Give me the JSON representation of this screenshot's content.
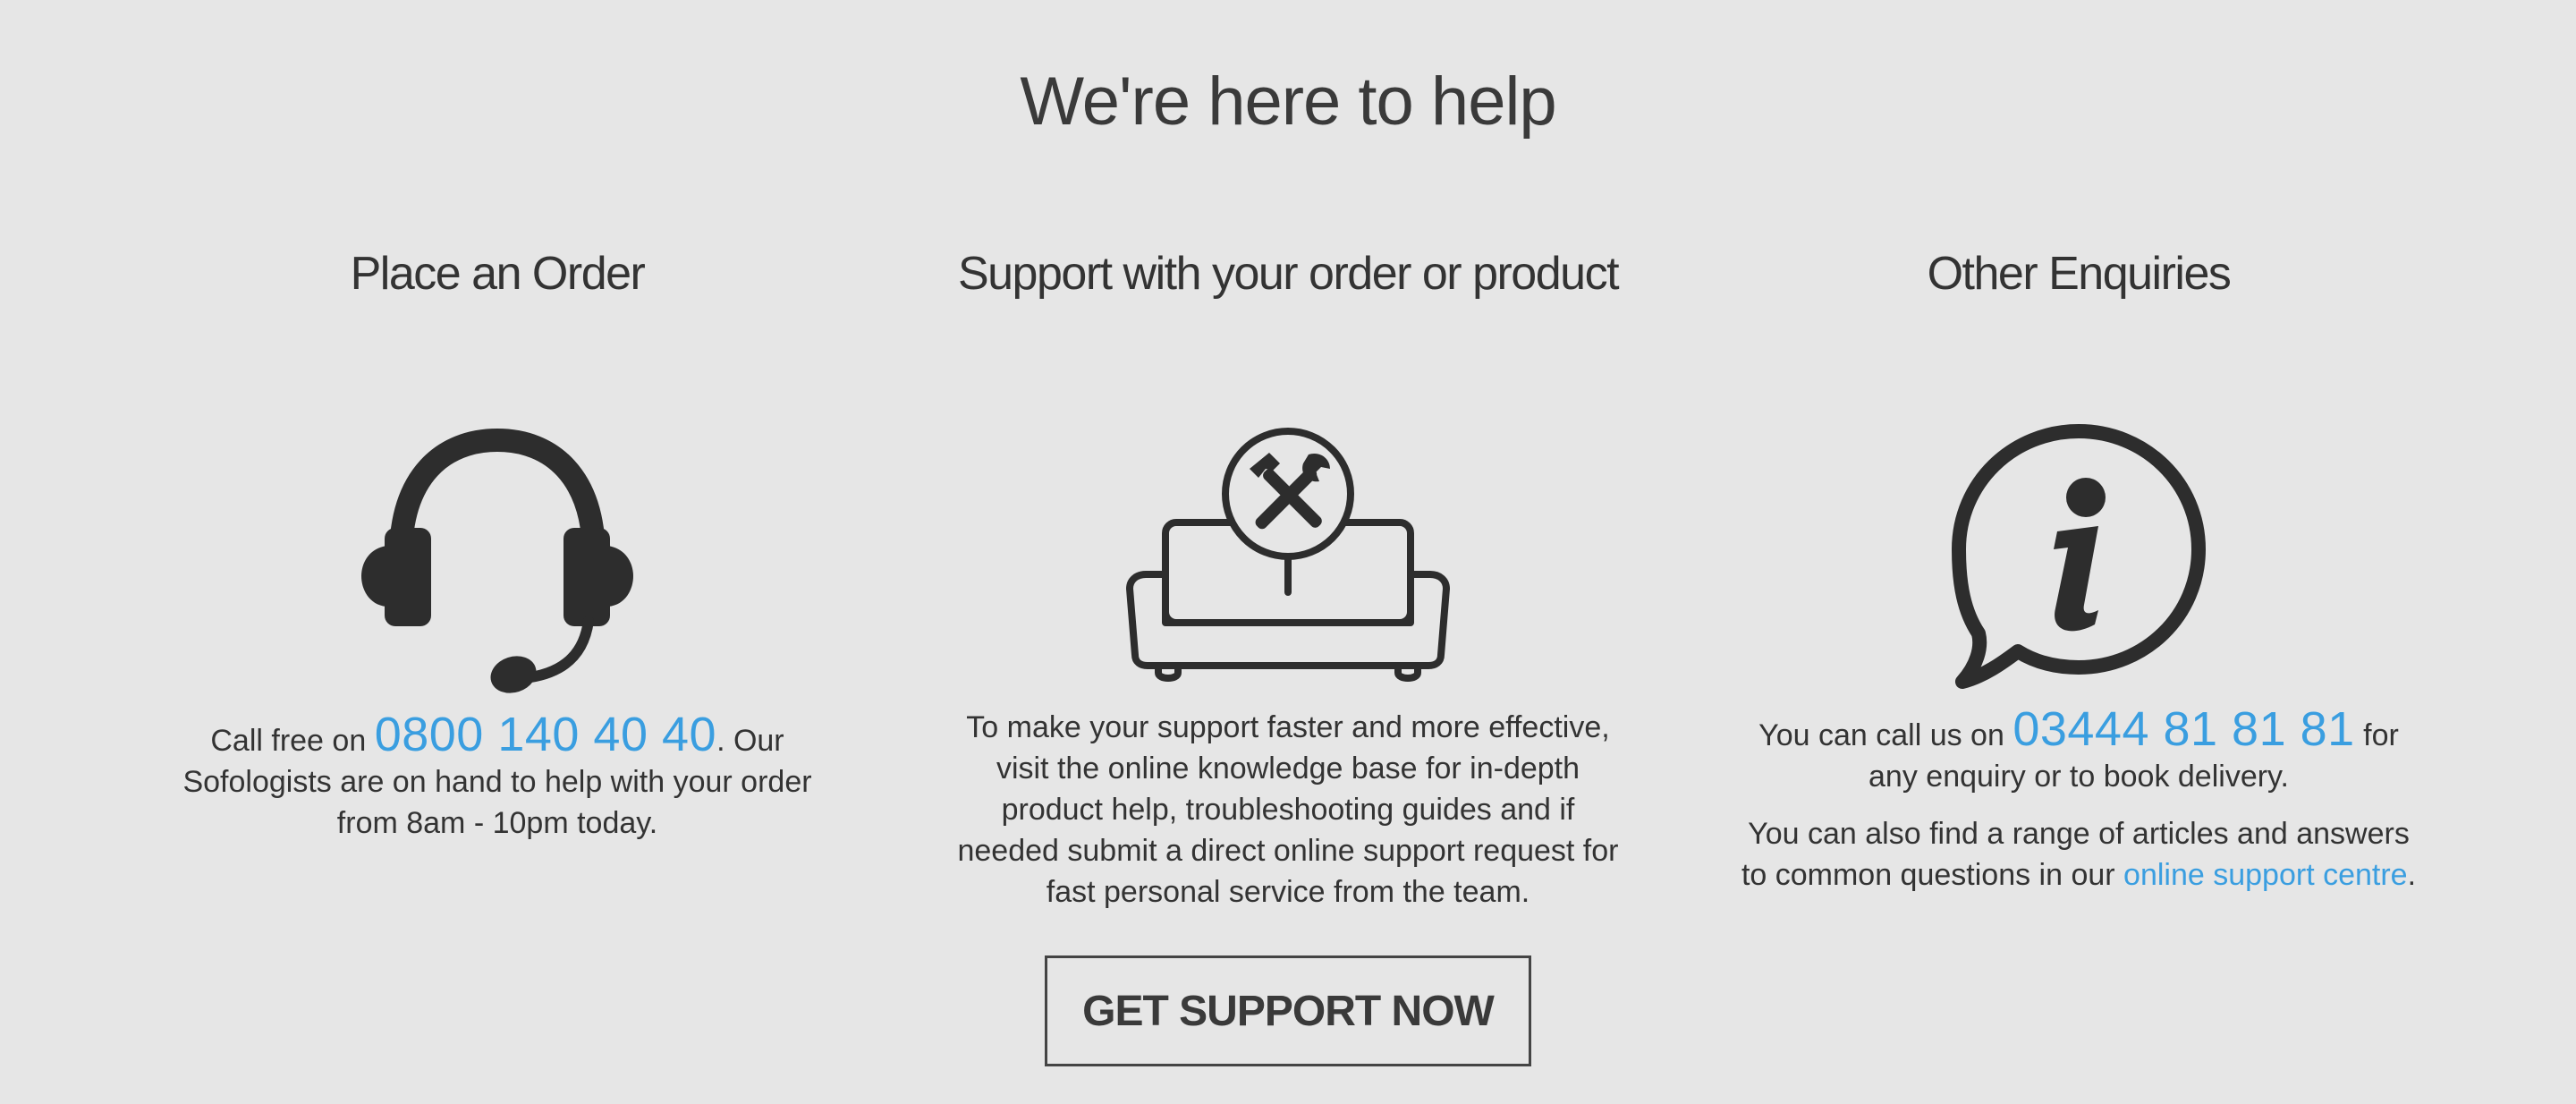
{
  "page": {
    "title": "We're here to help"
  },
  "colors": {
    "background": "#e6e6e6",
    "text": "#333333",
    "accent_link": "#3a9ee0",
    "icon": "#2d2d2d"
  },
  "columns": {
    "order": {
      "heading": "Place an Order",
      "icon": "headset-icon",
      "text_before": "Call free on ",
      "phone": "0800 140 40 40",
      "text_after": ". Our Sofologists are on hand to help with your order from 8am - 10pm today."
    },
    "support": {
      "heading": "Support with your order or product",
      "icon": "sofa-tools-icon",
      "text": "To make your support faster and more effective, visit the online knowledge base for in-depth product help, troubleshooting guides and if needed submit a direct online support request for fast personal service from the team.",
      "button_label": "GET SUPPORT NOW"
    },
    "other": {
      "heading": "Other Enquiries",
      "icon": "info-speech-bubble-icon",
      "text_before": "You can call us on ",
      "phone": "03444 81 81 81",
      "text_after": " for any enquiry or to book delivery.",
      "second_before": "You can also find a range of articles and answers to common questions in our ",
      "second_link": "online support centre",
      "second_after": "."
    }
  }
}
